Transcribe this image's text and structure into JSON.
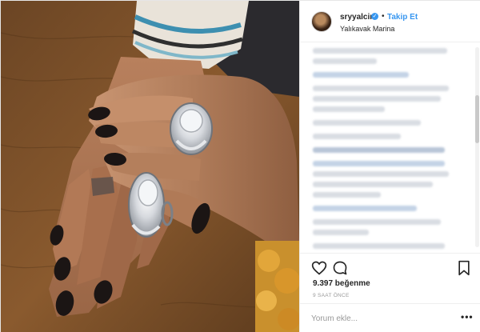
{
  "header": {
    "username": "sryyalcin",
    "verified_icon": "verified-badge-icon",
    "separator": "•",
    "follow_label": "Takip Et",
    "location": "Yalıkavak Marina"
  },
  "post": {
    "image_icon": "photo-hands-rings",
    "likes": "9.397 beğenme",
    "time_ago": "9 SAAT ÖNCE"
  },
  "actions": {
    "like_icon": "heart-icon",
    "comment_icon": "comment-icon",
    "save_icon": "bookmark-icon"
  },
  "comment_box": {
    "placeholder": "Yorum ekle...",
    "more_label": "•••"
  },
  "colors": {
    "accent": "#3897f0",
    "text": "#262626",
    "muted": "#999999",
    "border": "#efefef"
  }
}
